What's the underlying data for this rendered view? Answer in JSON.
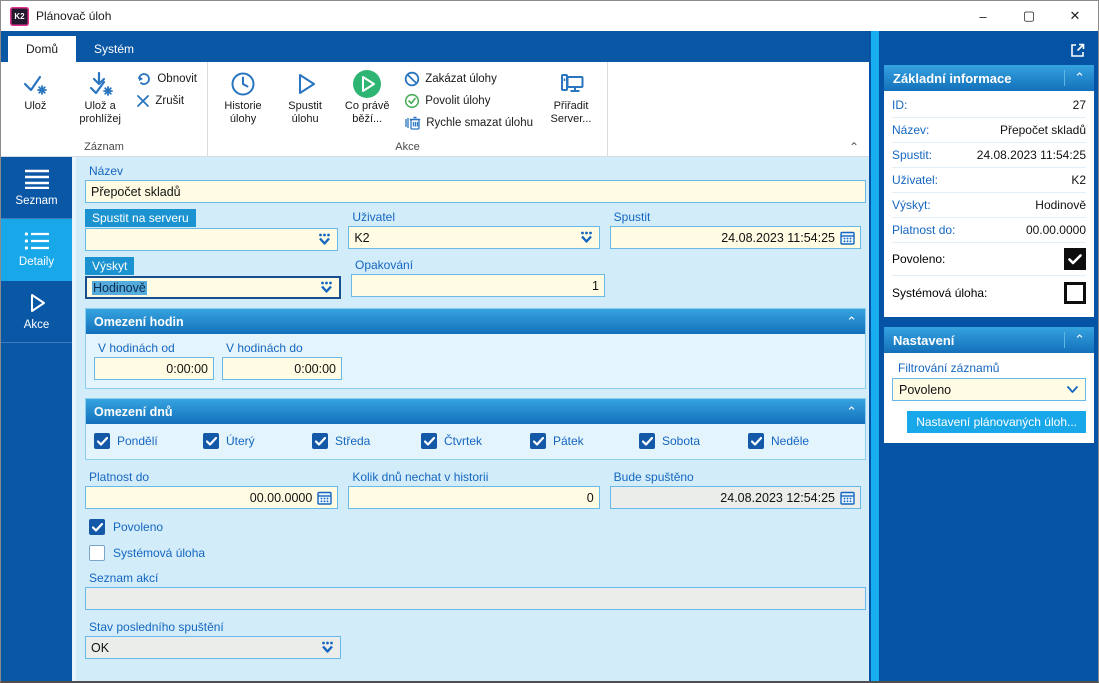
{
  "colors": {
    "dark_blue": "#0A57A5",
    "accent_cyan": "#18A8EA",
    "label_blue": "#1566C0",
    "field_yellow": "#FFFCE3",
    "ribbon_icon_blue": "#2A75C0",
    "green": "#2EB573"
  },
  "window": {
    "logo_text": "K2",
    "title": "Plánovač úloh",
    "minimize": "–",
    "maximize": "☐",
    "close": "✕"
  },
  "tabs": {
    "home": "Domů",
    "system": "Systém"
  },
  "ribbon": {
    "save": "Ulož",
    "save_and_view": "Ulož a prohlížej",
    "refresh": "Obnovit",
    "cancel": "Zrušit",
    "group_record": "Záznam",
    "history": "Historie úlohy",
    "run_task": "Spustit úlohu",
    "whats_running": "Co právě běží...",
    "disable_tasks": "Zakázat úlohy",
    "enable_tasks": "Povolit úlohy",
    "quick_delete": "Rychle smazat úlohu",
    "assign_server": "Přiřadit Server...",
    "group_actions": "Akce"
  },
  "sidebar": {
    "items": [
      {
        "label": "Seznam",
        "active": false
      },
      {
        "label": "Detaily",
        "active": true
      },
      {
        "label": "Akce",
        "active": false
      }
    ]
  },
  "form": {
    "nazev": {
      "label": "Název",
      "value": "Přepočet skladů"
    },
    "spustit_na_serveru": {
      "label": "Spustit na serveru",
      "value": ""
    },
    "uzivatel": {
      "label": "Uživatel",
      "value": "K2"
    },
    "spustit": {
      "label": "Spustit",
      "value": "24.08.2023 11:54:25"
    },
    "vyskyt": {
      "label": "Výskyt",
      "value": "Hodinově"
    },
    "opakovani": {
      "label": "Opakování",
      "value": "1"
    },
    "omezeni_hodin": {
      "title": "Omezení hodin",
      "od": {
        "label": "V hodinách od",
        "value": "0:00:00"
      },
      "do": {
        "label": "V hodinách do",
        "value": "0:00:00"
      }
    },
    "omezeni_dnu": {
      "title": "Omezení dnů",
      "days": [
        {
          "label": "Pondělí",
          "checked": true
        },
        {
          "label": "Úterý",
          "checked": true
        },
        {
          "label": "Středa",
          "checked": true
        },
        {
          "label": "Čtvrtek",
          "checked": true
        },
        {
          "label": "Pátek",
          "checked": true
        },
        {
          "label": "Sobota",
          "checked": true
        },
        {
          "label": "Neděle",
          "checked": true
        }
      ]
    },
    "platnost_do": {
      "label": "Platnost do",
      "value": "00.00.0000"
    },
    "kolik_dnu": {
      "label": "Kolik dnů nechat v historii",
      "value": "0"
    },
    "bude_spusteno": {
      "label": "Bude spuštěno",
      "value": "24.08.2023 12:54:25"
    },
    "povoleno": {
      "label": "Povoleno",
      "checked": true
    },
    "systemova_uloha": {
      "label": "Systémová úloha",
      "checked": false
    },
    "seznam_akci": {
      "label": "Seznam akcí",
      "value": ""
    },
    "stav": {
      "label": "Stav posledního spuštění",
      "value": "OK"
    }
  },
  "panel": {
    "basic": {
      "title": "Základní informace",
      "rows": [
        {
          "label": "ID:",
          "value": "27"
        },
        {
          "label": "Název:",
          "value": "Přepočet skladů"
        },
        {
          "label": "Spustit:",
          "value": "24.08.2023 11:54:25"
        },
        {
          "label": "Uživatel:",
          "value": "K2"
        },
        {
          "label": "Výskyt:",
          "value": "Hodinově"
        },
        {
          "label": "Platnost do:",
          "value": "00.00.0000"
        }
      ],
      "checks": [
        {
          "label": "Povoleno:",
          "checked": true
        },
        {
          "label": "Systémová úloha:",
          "checked": false
        }
      ]
    },
    "settings": {
      "title": "Nastavení",
      "filter_label": "Filtrování záznamů",
      "filter_value": "Povoleno",
      "button": "Nastavení plánovaných úloh..."
    }
  }
}
